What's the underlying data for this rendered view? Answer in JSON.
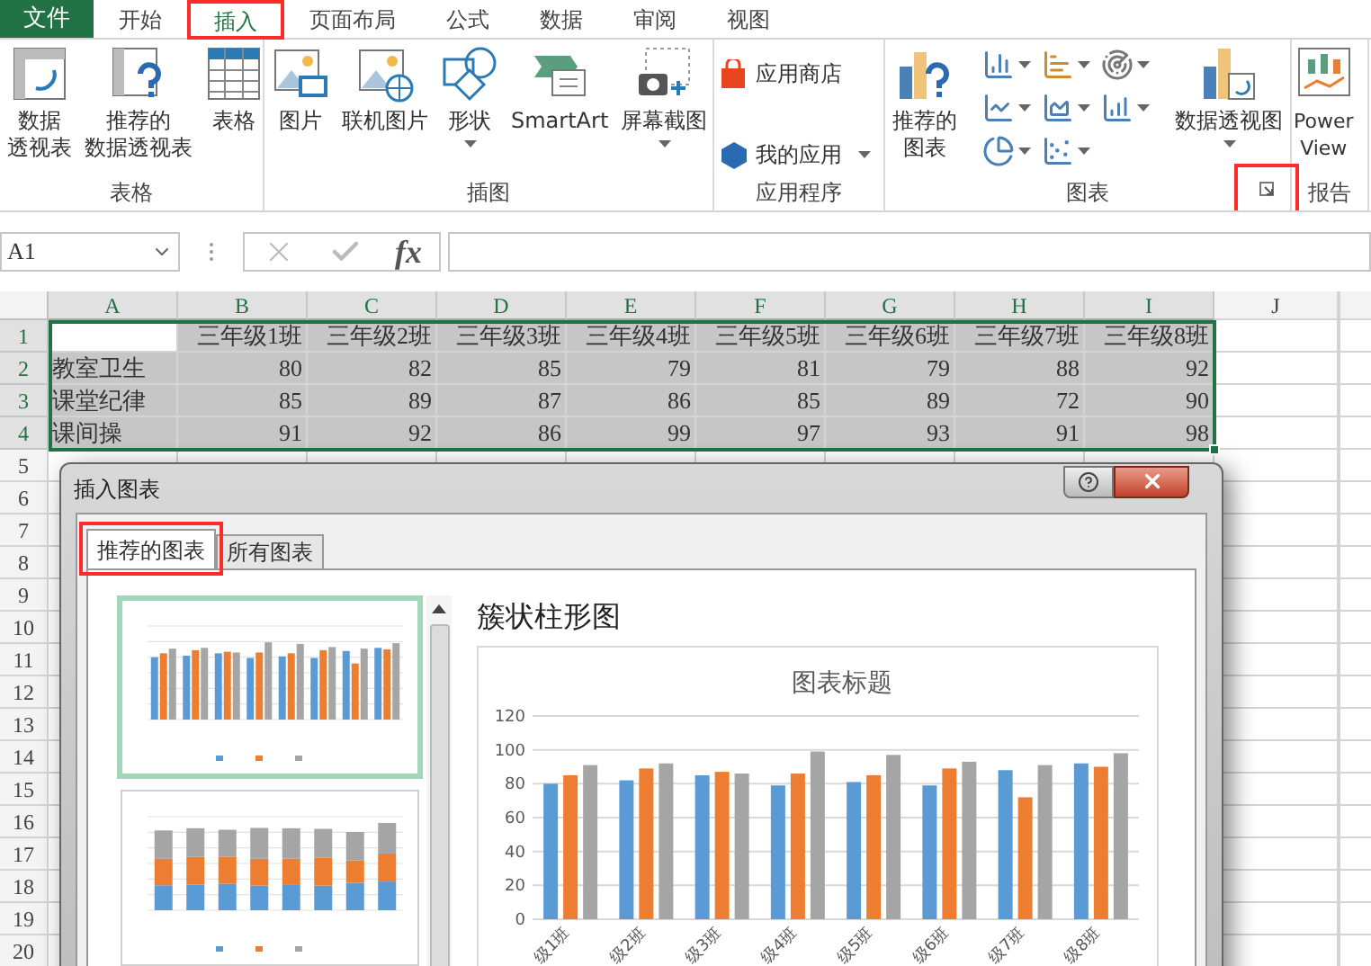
{
  "ribbon_tabs": [
    {
      "label": "文件",
      "kind": "file",
      "selected": false,
      "highlighted": false
    },
    {
      "label": "开始",
      "kind": "tab",
      "selected": false,
      "highlighted": false
    },
    {
      "label": "插入",
      "kind": "tab",
      "selected": true,
      "highlighted": true
    },
    {
      "label": "页面布局",
      "kind": "tab",
      "selected": false,
      "highlighted": false
    },
    {
      "label": "公式",
      "kind": "tab",
      "selected": false,
      "highlighted": false
    },
    {
      "label": "数据",
      "kind": "tab",
      "selected": false,
      "highlighted": false
    },
    {
      "label": "审阅",
      "kind": "tab",
      "selected": false,
      "highlighted": false
    },
    {
      "label": "视图",
      "kind": "tab",
      "selected": false,
      "highlighted": false
    }
  ],
  "ribbon_groups": [
    {
      "label": "表格",
      "items": [
        {
          "kind": "pivot_table",
          "lines": [
            "数据",
            "透视表"
          ],
          "dropdown": false
        },
        {
          "kind": "recommended_pivot",
          "lines": [
            "推荐的",
            "数据透视表"
          ],
          "dropdown": false
        },
        {
          "kind": "table",
          "lines": [
            "表格"
          ],
          "dropdown": false
        }
      ]
    },
    {
      "label": "插图",
      "items": [
        {
          "kind": "picture",
          "lines": [
            "图片"
          ],
          "dropdown": false
        },
        {
          "kind": "online_picture",
          "lines": [
            "联机图片"
          ],
          "dropdown": false
        },
        {
          "kind": "shapes",
          "lines": [
            "形状"
          ],
          "dropdown": true
        },
        {
          "kind": "smartart",
          "lines": [
            "SmartArt"
          ],
          "dropdown": false
        },
        {
          "kind": "screenshot",
          "lines": [
            "屏幕截图"
          ],
          "dropdown": true
        }
      ]
    },
    {
      "label": "应用程序",
      "items": [
        {
          "kind": "store",
          "lines": [
            "应用商店"
          ],
          "dropdown": false
        },
        {
          "kind": "my_apps",
          "lines": [
            "我的应用"
          ],
          "dropdown": true
        }
      ]
    },
    {
      "label": "图表",
      "launcher": {
        "highlighted": true
      },
      "items": [
        {
          "kind": "recommended_chart",
          "lines": [
            "推荐的",
            "图表"
          ],
          "dropdown": false
        },
        {
          "kind": "chart_gallery"
        },
        {
          "kind": "pivot_chart",
          "lines": [
            "数据透视图"
          ],
          "dropdown": true
        }
      ]
    },
    {
      "label": "报告",
      "items": [
        {
          "kind": "power_view",
          "lines": [
            "Power",
            "View"
          ],
          "dropdown": false
        }
      ]
    }
  ],
  "formula_bar": {
    "name_box": "A1",
    "fx": "fx"
  },
  "sheet": {
    "columns": [
      {
        "label": "A",
        "selected": true
      },
      {
        "label": "B",
        "selected": true
      },
      {
        "label": "C",
        "selected": true
      },
      {
        "label": "D",
        "selected": true
      },
      {
        "label": "E",
        "selected": true
      },
      {
        "label": "F",
        "selected": true
      },
      {
        "label": "G",
        "selected": true
      },
      {
        "label": "H",
        "selected": true
      },
      {
        "label": "I",
        "selected": true
      },
      {
        "label": "J",
        "selected": false
      }
    ],
    "class_headers": [
      "三年级1班",
      "三年级2班",
      "三年级3班",
      "三年级4班",
      "三年级5班",
      "三年级6班",
      "三年级7班",
      "三年级8班"
    ],
    "data_rows": [
      {
        "name": "教室卫生",
        "values": [
          "80",
          "82",
          "85",
          "79",
          "81",
          "79",
          "88",
          "92"
        ]
      },
      {
        "name": "课堂纪律",
        "values": [
          "85",
          "89",
          "87",
          "86",
          "85",
          "89",
          "72",
          "90"
        ]
      },
      {
        "name": "课间操",
        "values": [
          "91",
          "92",
          "86",
          "99",
          "97",
          "93",
          "91",
          "98"
        ]
      }
    ],
    "row_headers": [
      {
        "label": "1",
        "selected": true
      },
      {
        "label": "2",
        "selected": true
      },
      {
        "label": "3",
        "selected": true
      },
      {
        "label": "4",
        "selected": true
      },
      {
        "label": "5",
        "selected": false
      },
      {
        "label": "6",
        "selected": false
      },
      {
        "label": "7",
        "selected": false
      },
      {
        "label": "8",
        "selected": false
      },
      {
        "label": "9",
        "selected": false
      },
      {
        "label": "10",
        "selected": false
      },
      {
        "label": "11",
        "selected": false
      },
      {
        "label": "12",
        "selected": false
      },
      {
        "label": "13",
        "selected": false
      },
      {
        "label": "14",
        "selected": false
      },
      {
        "label": "15",
        "selected": false
      },
      {
        "label": "16",
        "selected": false
      },
      {
        "label": "17",
        "selected": false
      },
      {
        "label": "18",
        "selected": false
      },
      {
        "label": "19",
        "selected": false
      },
      {
        "label": "20",
        "selected": false
      }
    ]
  },
  "dialog": {
    "title": "插入图表",
    "tabs": [
      {
        "label": "推荐的图表",
        "selected": true,
        "highlighted": true
      },
      {
        "label": "所有图表",
        "selected": false,
        "highlighted": false
      }
    ],
    "thumbnails": [
      {
        "kind": "clustered",
        "selected": true
      },
      {
        "kind": "stacked",
        "selected": false
      }
    ],
    "preview_title": "簇状柱形图",
    "chart_data": {
      "type": "bar",
      "title": "图表标题",
      "categories": [
        "级1班",
        "级2班",
        "级3班",
        "级4班",
        "级5班",
        "级6班",
        "级7班",
        "级8班"
      ],
      "series": [
        {
          "color": "#5b9bd5",
          "values": [
            80,
            82,
            85,
            79,
            81,
            79,
            88,
            92
          ]
        },
        {
          "color": "#ed7d31",
          "values": [
            85,
            89,
            87,
            86,
            85,
            89,
            72,
            90
          ]
        },
        {
          "color": "#a5a5a5",
          "values": [
            91,
            92,
            86,
            99,
            97,
            93,
            91,
            98
          ]
        }
      ],
      "grid": true,
      "ylim": [
        0,
        120
      ],
      "yticks": [
        0,
        20,
        40,
        60,
        80,
        100,
        120
      ]
    }
  }
}
